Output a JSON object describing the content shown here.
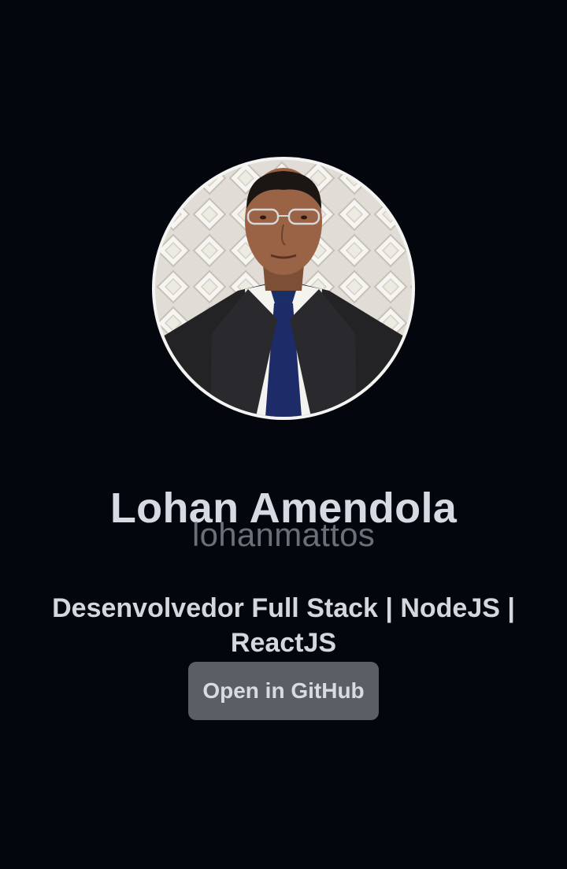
{
  "profile": {
    "name": "Lohan Amendola",
    "username": "lohanmattos",
    "bio": "Desenvolvedor Full Stack | NodeJS | ReactJS",
    "button_label": "Open in GitHub"
  },
  "colors": {
    "background": "#04060d",
    "name": "#d6dbe3",
    "username": "#6b7078",
    "bio": "#d3d7de",
    "button_bg": "#5a5f66",
    "button_text": "#d8dce2"
  }
}
